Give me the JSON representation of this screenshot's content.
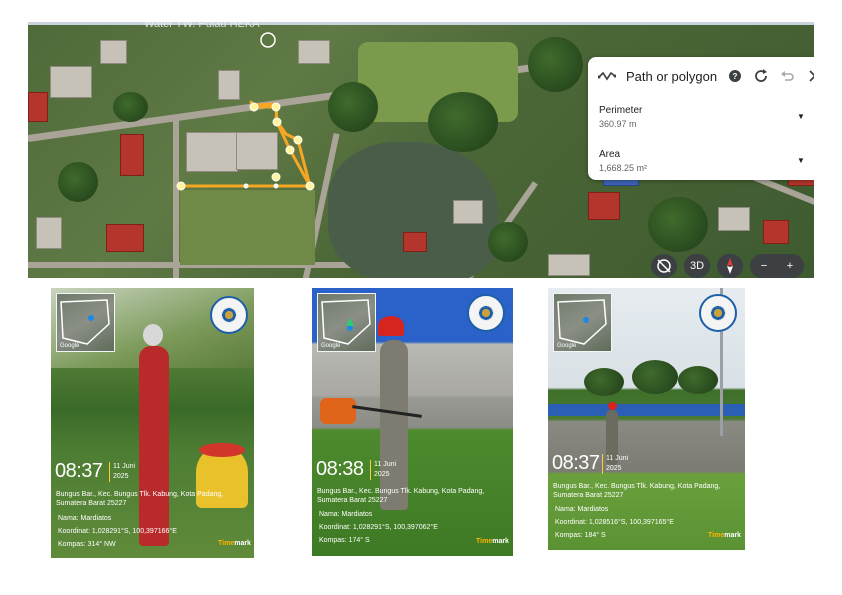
{
  "map": {
    "caption": "Water TW. Pulau HEKA",
    "panel": {
      "title": "Path or polygon",
      "perimeter_label": "Perimeter",
      "perimeter_value": "360.97 m",
      "area_label": "Area",
      "area_value": "1,668.25 m²",
      "icons": [
        "path-icon",
        "help-icon",
        "refresh-icon",
        "undo-icon",
        "close-icon"
      ]
    },
    "controls": {
      "view3d": "3D",
      "zoom_out": "−",
      "zoom_in": "+"
    },
    "accent": "#f5a623"
  },
  "photos": [
    {
      "time": "08:37",
      "date_line1": "11 Juni",
      "date_line2": "2025",
      "location": "Bungus Bar., Kec. Bungus Tlk. Kabung, Kota Padang, Sumatera Barat 25227",
      "name": "Nama: Mardiatos",
      "coords": "Koordinat: 1,028291°S, 100,397166°E",
      "compass": "Kompas: 314° NW",
      "brand_a": "Time",
      "brand_b": "mark"
    },
    {
      "time": "08:38",
      "date_line1": "11 Juni",
      "date_line2": "2025",
      "location": "Bungus Bar., Kec. Bungus Tlk. Kabung, Kota Padang, Sumatera Barat 25227",
      "name": "Nama: Mardiatos",
      "coords": "Koordinat: 1,028291°S, 100,397062°E",
      "compass": "Kompas: 174° S",
      "brand_a": "Time",
      "brand_b": "mark"
    },
    {
      "time": "08:37",
      "date_line1": "11 Juni",
      "date_line2": "2025",
      "location": "Bungus Bar., Kec. Bungus Tlk. Kabung, Kota Padang, Sumatera Barat 25227",
      "name": "Nama: Mardiatos",
      "coords": "Koordinat: 1,028516°S, 100,397165°E",
      "compass": "Kompas: 184° S",
      "brand_a": "Time",
      "brand_b": "mark"
    }
  ],
  "minimap_tag": "Google"
}
